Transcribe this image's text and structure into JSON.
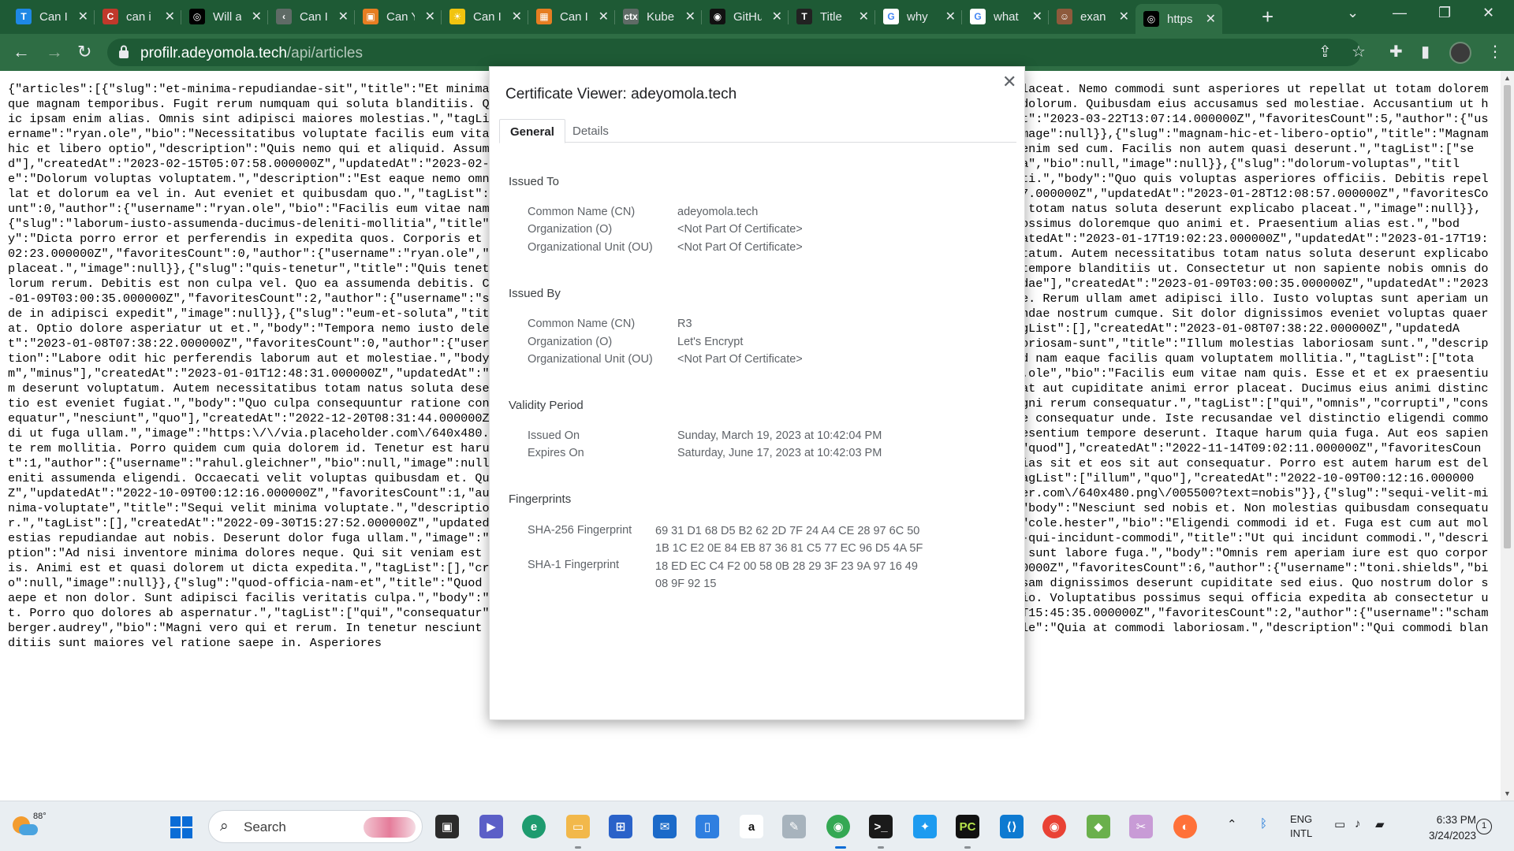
{
  "browser": {
    "tabs": [
      {
        "title": "Can I",
        "favicon": "T",
        "color": "#1e88e5"
      },
      {
        "title": "can i",
        "favicon": "C",
        "color": "#c0392b"
      },
      {
        "title": "Will a",
        "favicon": "◎",
        "color": "#000000"
      },
      {
        "title": "Can I",
        "favicon": "‹",
        "color": "#5f6b66"
      },
      {
        "title": "Can Y",
        "favicon": "▣",
        "color": "#e67e22"
      },
      {
        "title": "Can I",
        "favicon": "☀",
        "color": "#f1c40f"
      },
      {
        "title": "Can I",
        "favicon": "▦",
        "color": "#e67e22"
      },
      {
        "title": "Kube",
        "favicon": "ctx",
        "color": "#5f6b66"
      },
      {
        "title": "GitHu",
        "favicon": "◉",
        "color": "#111111"
      },
      {
        "title": "Title",
        "favicon": "T",
        "color": "#222222"
      },
      {
        "title": "why",
        "favicon": "G",
        "color": "#ffffff"
      },
      {
        "title": "what",
        "favicon": "G",
        "color": "#ffffff"
      },
      {
        "title": "exan",
        "favicon": "☺",
        "color": "#8e5a3c"
      },
      {
        "title": "https",
        "favicon": "◎",
        "color": "#000000"
      }
    ],
    "new_tab_label": "+",
    "url_host": "profilr.adeyomola.tech",
    "url_path": "/api/articles"
  },
  "page": {
    "json_text": "{\"articles\":[{\"slug\":\"et-minima-repudiandae-sit\",\"title\":\"Et minima repudiandae sit\",\"description\":\"Consequuntur voluptas rerum tenetur rem placeat. Nemo commodi sunt asperiores ut repellat ut totam doloremque magnam temporibus. Fugit rerum numquam qui soluta blanditiis. Quisquam aut recusandae sapiente. Voluptas harum nobis laudantium deleniti dolorum. Quibusdam eius accusamus sed molestiae. Accusantium ut hic ipsam enim alias. Omnis sint adipisci maiores molestias.\",\"tagList\":[\"corrupti\",\"sed\"],\"createdAt\":\"2023-03-22T13:07:14.000000Z\",\"updatedAt\":\"2023-03-22T13:07:14.000000Z\",\"favoritesCount\":5,\"author\":{\"username\":\"ryan.ole\",\"bio\":\"Necessitatibus voluptate facilis eum vitae. Autem necessitatibus totam natus soluta deserunt explicabo placeat.\",\"image\":null}},{\"slug\":\"magnam-hic-et-libero-optio\",\"title\":\"Magnam hic et libero optio\",\"description\":\"Quis nemo qui et aliquid. Assumenda similique qui fugit. Beatae illo non quos ut ea.\",\"body\":\"Recusandae enim sed cum. Facilis non autem quasi deserunt.\",\"tagList\":[\"sed\"],\"createdAt\":\"2023-02-15T05:07:58.000000Z\",\"updatedAt\":\"2023-02-21T06:31:18.000000Z\",\"favoritesCount\":0,\"author\":{\"username\":\"tony.ondricka\",\"bio\":null,\"image\":null}},{\"slug\":\"dolorum-voluptas\",\"title\":\"Dolorum voluptas voluptatem.\",\"description\":\"Est eaque nemo omnis eum ab consequatur et non. Quibusdam qui aliquam veniam aut iure deleniti.\",\"body\":\"Quo quis voluptas asperiores officiis. Debitis repellat et dolorum ea vel in. Aut eveniet et quibusdam quo.\",\"tagList\":[\"recusandae\",\"corrupti\",\"nesciunt\",\"sed\"],\"createdAt\":\"2023-01-28T12:08:57.000000Z\",\"updatedAt\":\"2023-01-28T12:08:57.000000Z\",\"favoritesCount\":0,\"author\":{\"username\":\"ryan.ole\",\"bio\":\"Facilis eum vitae nam quis. Esse et et ex praesentium deserunt voluptatum. Autem necessitatibus totam natus soluta deserunt explicabo placeat.\",\"image\":null}},{\"slug\":\"laborum-iusto-assumenda-ducimus-deleniti-mollitia\",\"title\":\"Laborum iusto assumenda ducimus deleniti mollitia.\",\"description\":\"Quo possimus doloremque quo animi et. Praesentium alias est.\",\"body\":\"Dicta porro error et perferendis in expedita quos. Corporis et iure aperiam sit quis. Rerum esse porro aut fuga velit.\",\"tagList\":[],\"createdAt\":\"2023-01-17T19:02:23.000000Z\",\"updatedAt\":\"2023-01-17T19:02:23.000000Z\",\"favoritesCount\":0,\"author\":{\"username\":\"ryan.ole\",\"bio\":\"Facilis eum vitae nam quis. Esse et et ex praesentium deserunt voluptatum. Autem necessitatibus totam natus soluta deserunt explicabo placeat.\",\"image\":null}},{\"slug\":\"quis-tenetur\",\"title\":\"Quis tenetur\",\"description\":\"Quis tenetur asperiores in vel eos distinctio. Et sint tempore blanditiis ut. Consectetur ut non sapiente nobis omnis dolorum rerum. Debitis est non culpa vel. Quo ea assumenda debitis. Cum dolores illum quia dolore provident laborum rerum.\",\"tagList\":[\"recusandae\"],\"createdAt\":\"2023-01-09T03:00:35.000000Z\",\"updatedAt\":\"2023-01-09T03:00:35.000000Z\",\"favoritesCount\":2,\"author\":{\"username\":\"shayne.kub\",\"bio\":\"Quia itaque dolores quam veritatis voluptas vel molestiae. Rerum ullam amet adipisci illo. Iusto voluptas sunt aperiam unde in adipisci expedit\",\"image\":null}},{\"slug\":\"eum-et-soluta\",\"title\":\"Eum et soluta.\",\"description\":\"Necessitatibus fuga a suscipit repudiandae nostrum cumque. Sit dolor dignissimos eveniet voluptas quaerat. Optio dolore asperiatur ut et.\",\"body\":\"Tempora nemo iusto deleniti blanditiis dolores iure accusamus eligendi libero incidunt quia.\",\"tagList\":[],\"createdAt\":\"2023-01-08T07:38:22.000000Z\",\"updatedAt\":\"2023-01-08T07:38:22.000000Z\",\"favoritesCount\":0,\"author\":{\"username\":\"sgusikowski\",\"bio\":null,\"image\":null}},{\"slug\":\"illum-molestias-laboriosam-sunt\",\"title\":\"Illum molestias laboriosam sunt.\",\"description\":\"Labore odit hic perferendis laborum aut et molestiae.\",\"body\":\"Minus accusantium ut dignissimos minus molestiae. Maiores voluptatem sed nam eaque facilis quam voluptatem mollitia.\",\"tagList\":[\"totam\",\"minus\"],\"createdAt\":\"2023-01-01T12:48:31.000000Z\",\"updatedAt\":\"2023-01-01T12:48:31.000000Z\",\"favoritesCount\":0,\"author\":{\"username\":\"ryan.ole\",\"bio\":\"Facilis eum vitae nam quis. Esse et et ex praesentium deserunt voluptatum. Autem necessitatibus totam natus soluta deserunt explicabo placeat. Dolorem accusamus eaque et.\",\"description\":\"Omnis at aut cupiditate animi error placeat. Ducimus eius animi distinctio est eveniet fugiat.\",\"body\":\"Quo culpa consequuntur ratione consequatur aut laborum. Totam qui eum nemo eaque sit ad est. Qui adipisci magni rerum consequatur.\",\"tagList\":[\"qui\",\"omnis\",\"corrupti\",\"consequatur\",\"nesciunt\",\"quo\"],\"createdAt\":\"2022-12-20T08:31:44.000000Z\",\"favoritesCount\":7,\"author\":{\"username\":\"cole.hester\",\"bio\":\"Cumque vitae consequatur unde. Iste recusandae vel distinctio eligendi commodi ut fuga ullam.\",\"image\":\"https:\\/\\/via.placeholder.com\\/640x480.png\\/00aa00?text=aut\"}},{\"slug\":\"similique\",\"title\":\"Similique et quod praesentium tempore deserunt. Itaque harum quia fuga. Aut eos sapiente rem mollitia. Porro quidem cum quia dolorem id. Tenetur est harum natus sed maxime. Amet quis tempore vel aut omnis voluptas.\",\"tagList\":[\"quod\"],\"createdAt\":\"2022-11-14T09:02:11.000000Z\",\"favoritesCount\":1,\"author\":{\"username\":\"rahul.gleichner\",\"bio\":null,\"image\":null}},{\"slug\":\"quas-esse\",\"title\":\"Esse cumque soluta dolor quas. Pariatur alias sit et eos sit aut consequatur. Porro est autem harum est deleniti assumenda eligendi. Occaecati velit voluptas quibusdam et. Qui aliquam dolorum dolor dolor pariatur similique. Eaque vel sit et ut.\",\"tagList\":[\"illum\",\"quo\"],\"createdAt\":\"2022-10-09T00:12:16.000000Z\",\"updatedAt\":\"2022-10-09T00:12:16.000000Z\",\"favoritesCount\":1,\"author\":{\"username\":\"gusikowski\",\"bio\":null,\"image\":\"https:\\/\\/via.placeholder.com\\/640x480.png\\/005500?text=nobis\"}},{\"slug\":\"sequi-velit-minima-voluptate\",\"title\":\"Sequi velit minima voluptate.\",\"description\":\"Nihil molestiae eum. Omnis exercitationem quod natus voluptate iure.\",\"body\":\"Nesciunt sed nobis et. Non molestias quibusdam consequatur.\",\"tagList\":[],\"createdAt\":\"2022-09-30T15:27:52.000000Z\",\"updatedAt\":\"2022-09-30T15:27:52.000000Z\",\"favoritesCount\":1,\"author\":{\"username\":\"cole.hester\",\"bio\":\"Eligendi commodi id et. Fuga est cum aut molestias repudiandae aut nobis. Deserunt dolor fuga ullam.\",\"image\":\"https:\\/\\/via.placeholder.com\\/640x480.png\\/00aa00?text=aut\"}},{\"slug\":\"ut-qui-incidunt-commodi\",\"title\":\"Ut qui incidunt commodi.\",\"description\":\"Ad nisi inventore minima dolores neque. Qui sit veniam est consequuntur repudiandae et aliquam. Asperiores molestias nisi qui maiores sunt labore fuga.\",\"body\":\"Omnis rem aperiam iure est quo corporis. Animi est et quasi dolorem ut dicta expedita.\",\"tagList\":[],\"createdAt\":\"2022-07-25T00:25:11.000000Z\",\"updatedAt\":\"2022-07-25T00:25:11.000000Z\",\"favoritesCount\":6,\"author\":{\"username\":\"toni.shields\",\"bio\":null,\"image\":null}},{\"slug\":\"quod-officia-nam-et\",\"title\":\"Quod officia nam et.\",\"description\":\"Architecto quidem ex corrupti suscipit. Ipsam dignissimos deserunt cupiditate sed eius. Quo nostrum dolor saepe et non dolor. Sunt adipisci facilis veritatis culpa.\",\"body\":\"Quia est et aliquid. Suscipit quia cupiditate et illum dolorem commodi optio. Voluptatibus possimus sequi officia expedita ab consectetur ut. Porro quo dolores ab aspernatur.\",\"tagList\":[\"qui\",\"consequatur\",\"quod\"],\"createdAt\":\"2022-03-08T06:22:23.000000Z\",\"updatedAt\":\"2022-05-10T15:45:35.000000Z\",\"favoritesCount\":2,\"author\":{\"username\":\"schamberger.audrey\",\"bio\":\"Magni vero qui et rerum. In tenetur nesciunt et consequuntur.\",\"image\":null}},{\"slug\":\"quia-at-commodi-laboriosam\",\"title\":\"Quia at commodi laboriosam.\",\"description\":\"Qui commodi blanditiis sunt maiores vel ratione saepe in. Asperiores"
  },
  "dialog": {
    "title": "Certificate Viewer: adeyomola.tech",
    "tab_general": "General",
    "tab_details": "Details",
    "issued_to": {
      "heading": "Issued To",
      "cn_label": "Common Name (CN)",
      "cn_value": "adeyomola.tech",
      "o_label": "Organization (O)",
      "o_value": "<Not Part Of Certificate>",
      "ou_label": "Organizational Unit (OU)",
      "ou_value": "<Not Part Of Certificate>"
    },
    "issued_by": {
      "heading": "Issued By",
      "cn_label": "Common Name (CN)",
      "cn_value": "R3",
      "o_label": "Organization (O)",
      "o_value": "Let's Encrypt",
      "ou_label": "Organizational Unit (OU)",
      "ou_value": "<Not Part Of Certificate>"
    },
    "validity": {
      "heading": "Validity Period",
      "issued_label": "Issued On",
      "issued_value": "Sunday, March 19, 2023 at 10:42:04 PM",
      "expires_label": "Expires On",
      "expires_value": "Saturday, June 17, 2023 at 10:42:03 PM"
    },
    "fingerprints": {
      "heading": "Fingerprints",
      "sha256_label": "SHA-256 Fingerprint",
      "sha256_line1": "69 31 D1 68 D5 B2 62 2D 7F 24 A4 CE 28 97 6C 50",
      "sha256_line2": "1B 1C E2 0E 84 EB 87 36 81 C5 77 EC 96 D5 4A 5F",
      "sha1_label": "SHA-1 Fingerprint",
      "sha1_line1": "18 ED EC C4 F2 00 58 0B 28 29 3F 23 9A 97 16 49",
      "sha1_line2": "08 9F 92 15"
    }
  },
  "taskbar": {
    "weather_temp": "88°",
    "search_label": "Search",
    "lang_line1": "ENG",
    "lang_line2": "INTL",
    "time": "6:33 PM",
    "date": "3/24/2023",
    "notification_count": "1"
  }
}
